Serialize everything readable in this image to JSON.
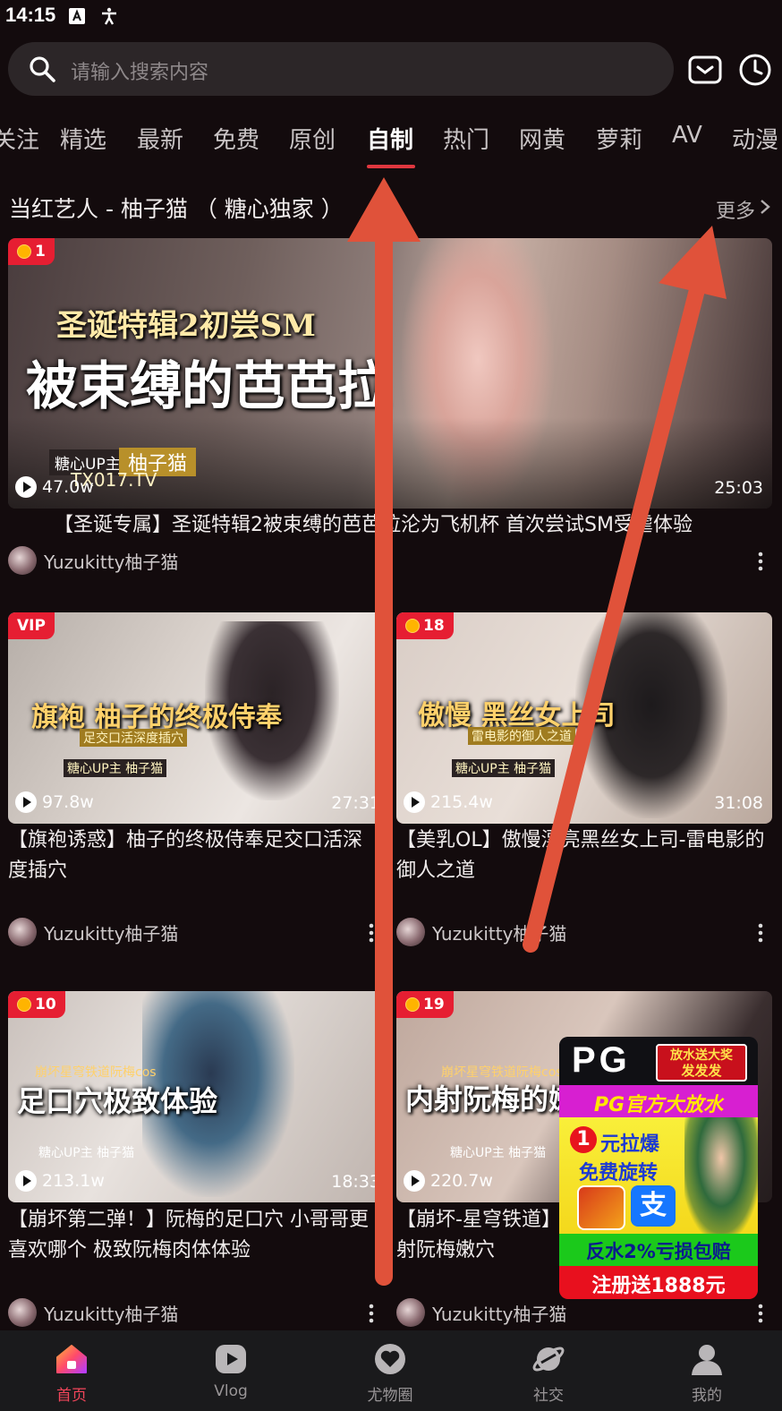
{
  "status_bar": {
    "time": "14:15"
  },
  "search": {
    "placeholder": "请输入搜索内容"
  },
  "tabs": [
    {
      "label": "关注"
    },
    {
      "label": "精选"
    },
    {
      "label": "最新"
    },
    {
      "label": "免费"
    },
    {
      "label": "原创"
    },
    {
      "label": "自制",
      "active": true
    },
    {
      "label": "热门"
    },
    {
      "label": "网黄"
    },
    {
      "label": "萝莉"
    },
    {
      "label": "AV"
    },
    {
      "label": "动漫"
    }
  ],
  "section": {
    "title": "当红艺人 - 柚子猫 （ 糖心独家 ）",
    "more_label": "更多"
  },
  "featured": {
    "badge": "1",
    "views": "47.0w",
    "duration": "25:03",
    "title": "【圣诞专属】圣诞特辑2被束缚的芭芭拉沦为飞机杯 首次尝试SM受虐体验",
    "author": "Yuzukitty柚子猫",
    "overlay_sub": "圣诞特辑2初尝SM",
    "overlay_main": "被束缚的芭芭拉",
    "overlay_tag": "糖心UP主",
    "overlay_name": "柚子猫",
    "overlay_site": "TX017.TV"
  },
  "videos": [
    {
      "badge": "VIP",
      "coin": false,
      "views": "97.8w",
      "duration": "27:31",
      "title": "【旗袍诱惑】柚子的终极侍奉足交口活深度插穴",
      "author": "Yuzukitty柚子猫",
      "overlay_main": "旗袍 柚子的终极侍奉",
      "overlay_sub": "足交口活深度插穴",
      "overlay_tag": "糖心UP主 柚子猫"
    },
    {
      "badge": "18",
      "coin": true,
      "views": "215.4w",
      "duration": "31:08",
      "title": "【美乳OL】傲慢漂亮黑丝女上司-雷电影的御人之道",
      "author": "Yuzukitty柚子猫",
      "overlay_main": "傲慢 黑丝女上司",
      "overlay_sub": "雷电影的御人之道",
      "overlay_tag": "糖心UP主 柚子猫"
    },
    {
      "badge": "10",
      "coin": true,
      "views": "213.1w",
      "duration": "18:33",
      "title": "【崩坏第二弹！】阮梅的足口穴 小哥哥更喜欢哪个 极致阮梅肉体体验",
      "author": "Yuzukitty柚子猫",
      "overlay_main": "足口穴极致体验",
      "overlay_sub": "崩坏星穹铁道阮梅cos",
      "overlay_tag": "糖心UP主 柚子猫"
    },
    {
      "badge": "19",
      "coin": true,
      "views": "220.7w",
      "duration": "",
      "title": "【崩坏-星穹铁道】阮梅cos 沉浸式体验内射阮梅嫩穴",
      "author": "Yuzukitty柚子猫",
      "overlay_main": "内射阮梅的嫩",
      "overlay_sub": "崩坏星穹铁道阮梅cos",
      "overlay_tag": "糖心UP主 柚子猫"
    }
  ],
  "ad": {
    "logo": "PG",
    "tag_line1": "放水送大奖",
    "tag_line2": "发发发",
    "banner": "PG官方大放水",
    "promo_num": "1",
    "promo_text": "元拉爆",
    "free_spin": "免费旋转",
    "pay_icon": "支",
    "rebate": "反水2%亏损包赔",
    "register": "注册送1888元"
  },
  "bottom_nav": [
    {
      "label": "首页",
      "icon": "home-icon",
      "active": true
    },
    {
      "label": "Vlog",
      "icon": "play-icon"
    },
    {
      "label": "尤物圈",
      "icon": "heart-circle-icon"
    },
    {
      "label": "社交",
      "icon": "planet-icon"
    },
    {
      "label": "我的",
      "icon": "user-icon"
    }
  ],
  "colors": {
    "accent": "#e0373f",
    "badge": "#e61e32",
    "background": "#130b0d",
    "arrow": "#e0523a"
  }
}
